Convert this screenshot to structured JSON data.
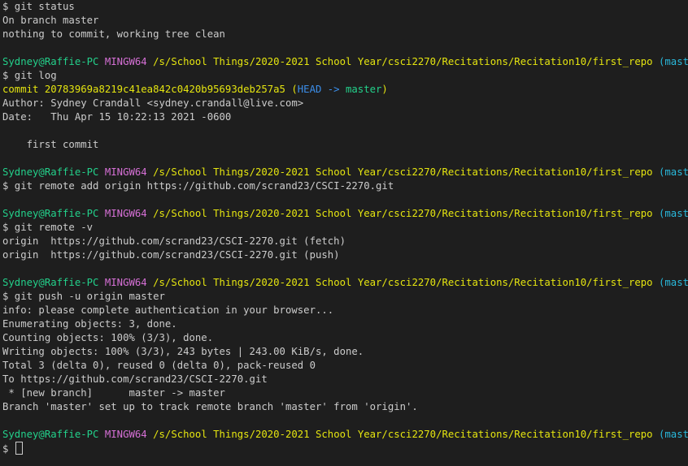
{
  "lines": [
    {
      "type": "cmd",
      "text": "$ git status"
    },
    {
      "type": "out",
      "text": "On branch master"
    },
    {
      "type": "out",
      "text": "nothing to commit, working tree clean"
    },
    {
      "type": "blank"
    },
    {
      "type": "prompt",
      "user": "Sydney@Raffie-PC",
      "sys": "MINGW64",
      "path": "/s/School Things/2020-2021 School Year/csci2270/Recitations/Recitation10/first_repo",
      "branch": "(master)"
    },
    {
      "type": "cmd",
      "text": "$ git log"
    },
    {
      "type": "commit",
      "prefix": "commit 20783969a8219c41ea842c0420b95693deb257a5 (",
      "head": "HEAD -> ",
      "master": "master",
      "suffix": ")"
    },
    {
      "type": "out",
      "text": "Author: Sydney Crandall <sydney.crandall@live.com>"
    },
    {
      "type": "out",
      "text": "Date:   Thu Apr 15 10:22:13 2021 -0600"
    },
    {
      "type": "blank"
    },
    {
      "type": "out",
      "text": "    first commit"
    },
    {
      "type": "blank"
    },
    {
      "type": "prompt",
      "user": "Sydney@Raffie-PC",
      "sys": "MINGW64",
      "path": "/s/School Things/2020-2021 School Year/csci2270/Recitations/Recitation10/first_repo",
      "branch": "(master)"
    },
    {
      "type": "cmd",
      "text": "$ git remote add origin https://github.com/scrand23/CSCI-2270.git"
    },
    {
      "type": "blank"
    },
    {
      "type": "prompt",
      "user": "Sydney@Raffie-PC",
      "sys": "MINGW64",
      "path": "/s/School Things/2020-2021 School Year/csci2270/Recitations/Recitation10/first_repo",
      "branch": "(master)"
    },
    {
      "type": "cmd",
      "text": "$ git remote -v"
    },
    {
      "type": "out",
      "text": "origin  https://github.com/scrand23/CSCI-2270.git (fetch)"
    },
    {
      "type": "out",
      "text": "origin  https://github.com/scrand23/CSCI-2270.git (push)"
    },
    {
      "type": "blank"
    },
    {
      "type": "prompt",
      "user": "Sydney@Raffie-PC",
      "sys": "MINGW64",
      "path": "/s/School Things/2020-2021 School Year/csci2270/Recitations/Recitation10/first_repo",
      "branch": "(master)"
    },
    {
      "type": "cmd",
      "text": "$ git push -u origin master"
    },
    {
      "type": "out",
      "text": "info: please complete authentication in your browser..."
    },
    {
      "type": "out",
      "text": "Enumerating objects: 3, done."
    },
    {
      "type": "out",
      "text": "Counting objects: 100% (3/3), done."
    },
    {
      "type": "out",
      "text": "Writing objects: 100% (3/3), 243 bytes | 243.00 KiB/s, done."
    },
    {
      "type": "out",
      "text": "Total 3 (delta 0), reused 0 (delta 0), pack-reused 0"
    },
    {
      "type": "out",
      "text": "To https://github.com/scrand23/CSCI-2270.git"
    },
    {
      "type": "out",
      "text": " * [new branch]      master -> master"
    },
    {
      "type": "out",
      "text": "Branch 'master' set up to track remote branch 'master' from 'origin'."
    },
    {
      "type": "blank"
    },
    {
      "type": "prompt",
      "user": "Sydney@Raffie-PC",
      "sys": "MINGW64",
      "path": "/s/School Things/2020-2021 School Year/csci2270/Recitations/Recitation10/first_repo",
      "branch": "(master)"
    },
    {
      "type": "input",
      "text": "$ "
    }
  ],
  "colors": {
    "background": "#1e1e1e",
    "text": "#cccccc",
    "user": "#23d18b",
    "mingw": "#d670d6",
    "path": "#e5e510",
    "branch": "#29b8db",
    "head": "#3b8eea"
  }
}
